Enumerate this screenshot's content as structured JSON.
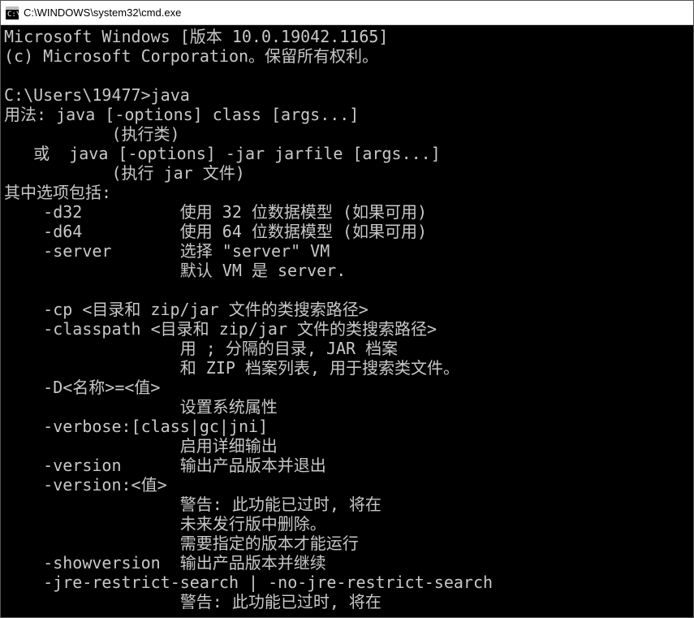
{
  "window": {
    "title": "C:\\WINDOWS\\system32\\cmd.exe"
  },
  "terminal": {
    "lines": [
      "Microsoft Windows [版本 10.0.19042.1165]",
      "(c) Microsoft Corporation。保留所有权利。",
      "",
      "C:\\Users\\19477>java",
      "用法: java [-options] class [args...]",
      "           (执行类)",
      "   或  java [-options] -jar jarfile [args...]",
      "           (执行 jar 文件)",
      "其中选项包括:",
      "    -d32          使用 32 位数据模型 (如果可用)",
      "    -d64          使用 64 位数据模型 (如果可用)",
      "    -server       选择 \"server\" VM",
      "                  默认 VM 是 server.",
      "",
      "    -cp <目录和 zip/jar 文件的类搜索路径>",
      "    -classpath <目录和 zip/jar 文件的类搜索路径>",
      "                  用 ; 分隔的目录, JAR 档案",
      "                  和 ZIP 档案列表, 用于搜索类文件。",
      "    -D<名称>=<值>",
      "                  设置系统属性",
      "    -verbose:[class|gc|jni]",
      "                  启用详细输出",
      "    -version      输出产品版本并退出",
      "    -version:<值>",
      "                  警告: 此功能已过时, 将在",
      "                  未来发行版中删除。",
      "                  需要指定的版本才能运行",
      "    -showversion  输出产品版本并继续",
      "    -jre-restrict-search | -no-jre-restrict-search",
      "                  警告: 此功能已过时, 将在"
    ]
  }
}
